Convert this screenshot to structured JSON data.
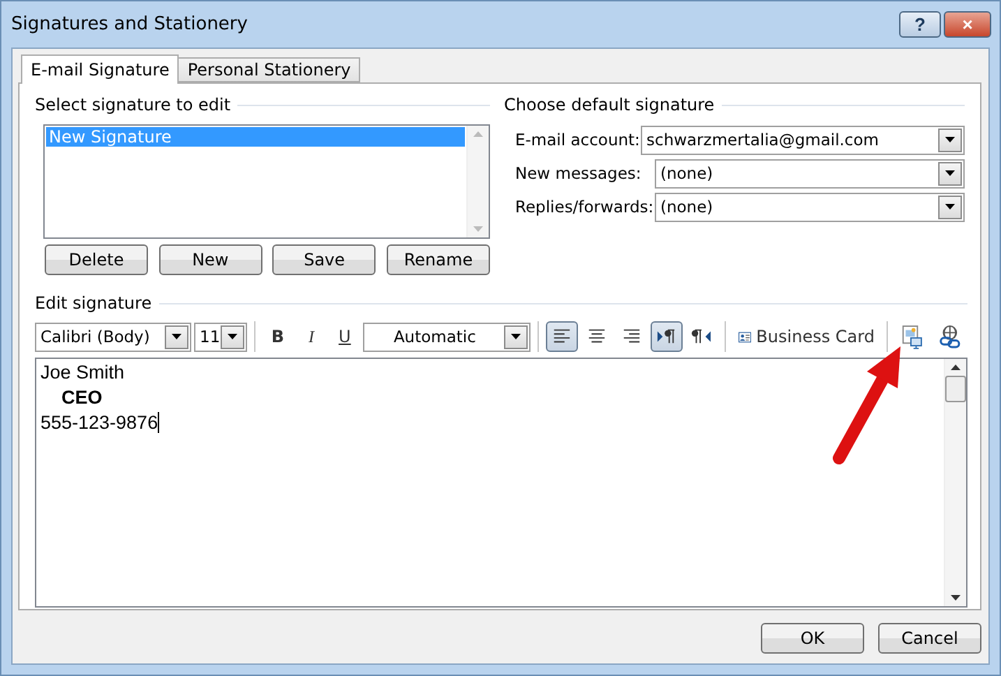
{
  "window": {
    "title": "Signatures and Stationery",
    "controls": [
      {
        "kind": "help",
        "label": "?"
      },
      {
        "kind": "close",
        "label": "×"
      }
    ]
  },
  "tabs": [
    {
      "label": "E-mail Signature",
      "selected": true
    },
    {
      "label": "Personal Stationery",
      "selected": false
    }
  ],
  "select_signature": {
    "heading": "Select signature to edit",
    "items": [
      {
        "label": "New Signature",
        "selected": true
      }
    ],
    "buttons": [
      "Delete",
      "New",
      "Save",
      "Rename"
    ]
  },
  "default_signature": {
    "heading": "Choose default signature",
    "fields": [
      {
        "label": "E-mail account:",
        "value": "schwarzmertalia@gmail.com"
      },
      {
        "label": "New messages:",
        "value": "(none)"
      },
      {
        "label": "Replies/forwards:",
        "value": "(none)"
      }
    ]
  },
  "edit_signature": {
    "heading": "Edit signature",
    "toolbar": {
      "font": "Calibri (Body)",
      "size": "11",
      "format_buttons": [
        {
          "kind": "bold",
          "label": "B"
        },
        {
          "kind": "italic",
          "label": "I"
        },
        {
          "kind": "underline",
          "label": "U"
        }
      ],
      "color_label": "Automatic",
      "paragraph_buttons": [
        {
          "kind": "align-left",
          "pressed": true
        },
        {
          "kind": "align-center",
          "pressed": false
        },
        {
          "kind": "align-right",
          "pressed": false
        },
        {
          "kind": "ltr",
          "pressed": true
        },
        {
          "kind": "rtl",
          "pressed": false
        }
      ],
      "business_card": "Business Card",
      "insert_buttons": [
        {
          "kind": "picture"
        },
        {
          "kind": "hyperlink"
        }
      ]
    },
    "lines": [
      {
        "text": "Joe Smith",
        "bold": false,
        "indented": false,
        "caret": false
      },
      {
        "text": "CEO",
        "bold": true,
        "indented": true,
        "caret": false
      },
      {
        "text": "555-123-9876",
        "bold": false,
        "indented": false,
        "caret": true
      }
    ]
  },
  "buttons": [
    "OK",
    "Cancel"
  ]
}
